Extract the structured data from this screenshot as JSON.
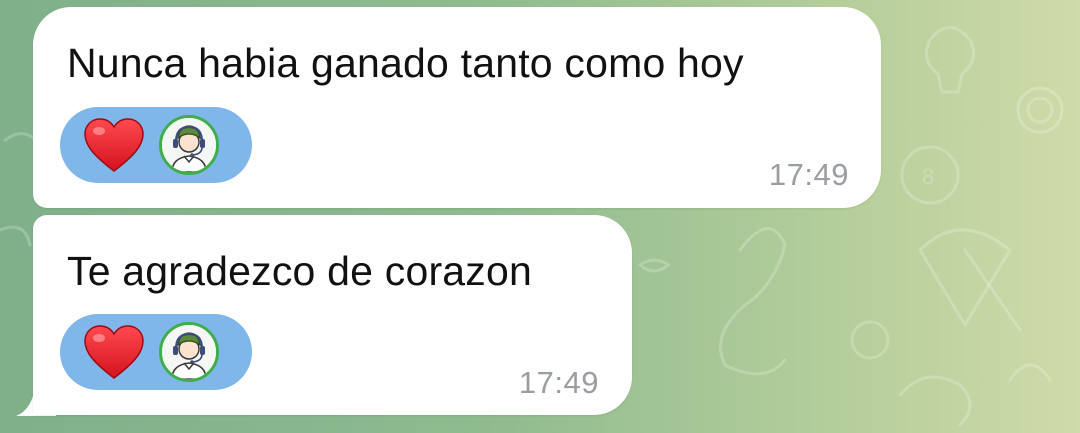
{
  "chat": {
    "messages": [
      {
        "text": "Nunca habia ganado tanto como hoy",
        "time": "17:49",
        "reaction": {
          "emoji_icon": "red-heart-icon",
          "reactor_avatar": "support-agent-avatar"
        }
      },
      {
        "text": "Te agradezco de corazon",
        "time": "17:49",
        "reaction": {
          "emoji_icon": "red-heart-icon",
          "reactor_avatar": "support-agent-avatar"
        }
      }
    ]
  },
  "colors": {
    "bubble": "#ffffff",
    "reaction_pill": "#7fb7ea",
    "heart": "#e8202a",
    "timestamp": "#9a9da2",
    "avatar_ring": "#3fae49"
  }
}
